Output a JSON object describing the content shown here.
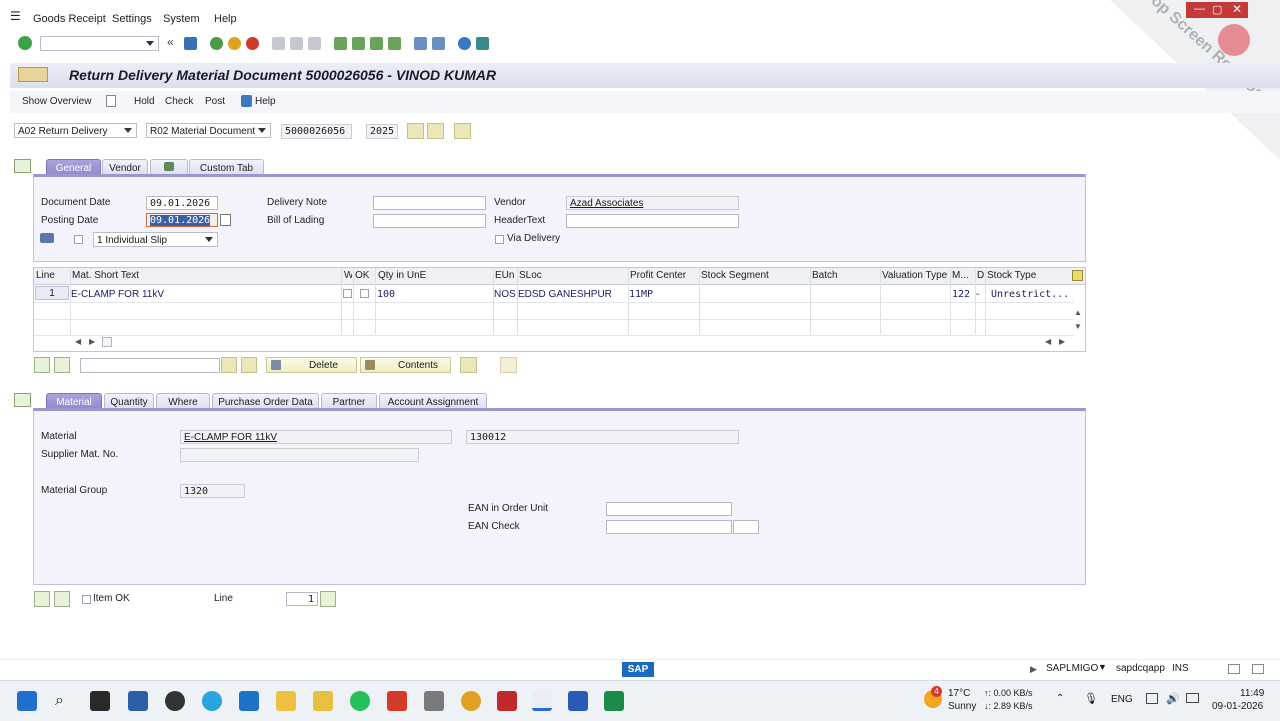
{
  "menu": {
    "items": [
      "Goods Receipt",
      "Settings",
      "System",
      "Help"
    ]
  },
  "title": "Return Delivery Material Document 5000026056 - VINOD KUMAR",
  "app_toolbar": {
    "show_overview": "Show Overview",
    "hold": "Hold",
    "check": "Check",
    "post": "Post",
    "help": "Help"
  },
  "action_select": {
    "action": "A02 Return Delivery",
    "reference": "R02 Material Document",
    "doc_number": "5000026056",
    "year": "2025"
  },
  "header_tabs": [
    "General",
    "Vendor",
    "Custom Tab"
  ],
  "header": {
    "document_date_label": "Document Date",
    "document_date": "09.01.2026",
    "posting_date_label": "Posting Date",
    "posting_date": "09.01.2026",
    "slip_option": "1 Individual Slip",
    "delivery_note_label": "Delivery Note",
    "delivery_note": "",
    "bill_of_lading_label": "Bill of Lading",
    "bill_of_lading": "",
    "vendor_label": "Vendor",
    "vendor": "Azad Associates",
    "header_text_label": "HeaderText",
    "header_text": "",
    "via_delivery_label": "Via Delivery"
  },
  "items_table": {
    "columns": [
      "Line",
      "Mat. Short Text",
      "W",
      "OK",
      "Qty in UnE",
      "EUn",
      "SLoc",
      "Profit Center",
      "Stock Segment",
      "Batch",
      "Valuation Type",
      "M...",
      "D",
      "Stock Type"
    ],
    "rows": [
      {
        "line": "1",
        "mat_short_text": "E-CLAMP FOR 11kV",
        "qty": "100",
        "eun": "NOS",
        "sloc": "EDSD GANESHPUR",
        "profit_center": "11MP",
        "stock_segment": "",
        "batch": "",
        "valuation_type": "",
        "mvt": "122",
        "d": "-",
        "stock_type": "Unrestrict..."
      }
    ]
  },
  "item_toolbar": {
    "delete": "Delete",
    "contents": "Contents"
  },
  "detail_tabs": [
    "Material",
    "Quantity",
    "Where",
    "Purchase Order Data",
    "Partner",
    "Account Assignment"
  ],
  "detail": {
    "material_label": "Material",
    "material_text": "E-CLAMP FOR 11kV",
    "material_number": "130012",
    "supplier_mat_label": "Supplier Mat. No.",
    "supplier_mat": "",
    "material_group_label": "Material Group",
    "material_group": "1320",
    "ean_order_label": "EAN in Order Unit",
    "ean_check_label": "EAN Check"
  },
  "footer": {
    "item_ok_label": "Item OK",
    "line_label": "Line",
    "line_value": "1"
  },
  "status": {
    "program": "SAPLMIGO",
    "server": "sapdcqapp",
    "mode": "INS"
  },
  "taskbar": {
    "weather_temp": "17°C",
    "weather_text": "Sunny",
    "weather_badge": "4",
    "upload": "↑: 0.00 KB/s",
    "download": "↓: 2.89 KB/s",
    "lang": "ENG",
    "time": "11:49",
    "date": "09-01-2026"
  },
  "watermark": "iTop Screen Recorder",
  "colors": {
    "tab_active": "#9e9ad6",
    "panel_bg": "#f4f2fb",
    "grid_text": "#1b1b6b"
  }
}
